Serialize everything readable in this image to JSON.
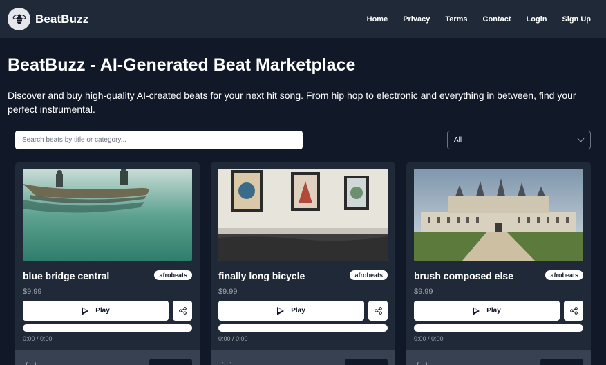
{
  "brand": {
    "name": "BeatBuzz",
    "logo_icon": "bee-icon"
  },
  "nav": {
    "items": [
      {
        "label": "Home"
      },
      {
        "label": "Privacy"
      },
      {
        "label": "Terms"
      },
      {
        "label": "Contact"
      },
      {
        "label": "Login"
      },
      {
        "label": "Sign Up"
      }
    ]
  },
  "hero": {
    "title": "BeatBuzz - AI-Generated Beat Marketplace",
    "description": "Discover and buy high-quality AI-created beats for your next hit song. From hip hop to electronic and everything in between, find your perfect instrumental."
  },
  "search": {
    "placeholder": "Search beats by title or category...",
    "value": ""
  },
  "filter": {
    "selected": "All"
  },
  "cards": [
    {
      "title": "blue bridge central",
      "category": "afrobeats",
      "price": "$9.99",
      "play_label": "Play",
      "time": "0:00 / 0:00",
      "progress": 0
    },
    {
      "title": "finally long bicycle",
      "category": "afrobeats",
      "price": "$9.99",
      "play_label": "Play",
      "time": "0:00 / 0:00",
      "progress": 0
    },
    {
      "title": "brush composed else",
      "category": "afrobeats",
      "price": "$9.99",
      "play_label": "Play",
      "time": "0:00 / 0:00",
      "progress": 0
    }
  ],
  "colors": {
    "background": "#111827",
    "navbar": "#1f2937",
    "card": "#1f2937",
    "muted_text": "#9ca3af"
  }
}
